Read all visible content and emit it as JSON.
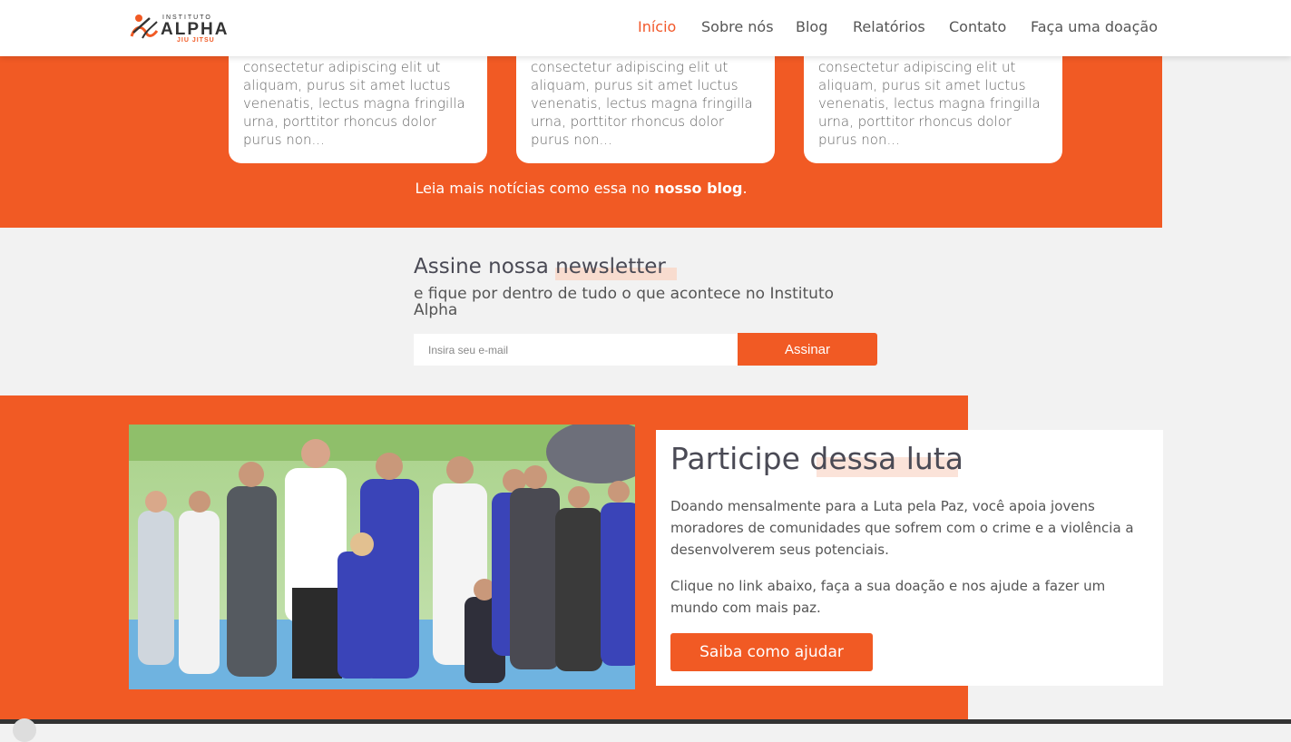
{
  "header": {
    "logo": {
      "line1": "INSTITUTO",
      "line2": "ALPHA",
      "line3": "JIU JITSU"
    },
    "nav": [
      {
        "label": "Início",
        "active": true
      },
      {
        "label": "Sobre nós",
        "active": false
      },
      {
        "label": "Blog",
        "active": false
      },
      {
        "label": "Relatórios",
        "active": false
      },
      {
        "label": "Contato",
        "active": false
      },
      {
        "label": "Faça uma doação",
        "active": false
      }
    ]
  },
  "blog": {
    "cards": [
      {
        "excerpt": "consectetur adipiscing elit ut aliquam, purus sit amet luctus venenatis, lectus magna fringilla urna, porttitor rhoncus dolor purus non..."
      },
      {
        "excerpt": "consectetur adipiscing elit ut aliquam, purus sit amet luctus venenatis, lectus magna fringilla urna, porttitor rhoncus dolor purus non..."
      },
      {
        "excerpt": "consectetur adipiscing elit ut aliquam, purus sit amet luctus venenatis, lectus magna fringilla urna, porttitor rhoncus dolor purus non..."
      }
    ],
    "more_prefix": "Leia mais notícias como essa no ",
    "more_link": "nosso blog",
    "more_suffix": "."
  },
  "newsletter": {
    "title": "Assine nossa newsletter",
    "subtitle": "e fique por dentro de tudo o que acontece no Instituto Alpha",
    "input_placeholder": "Insira seu e-mail",
    "button": "Assinar"
  },
  "participe": {
    "title": "Participe dessa luta",
    "paragraph1": "Doando mensalmente para a Luta pela Paz, você apoia jovens moradores de comunidades que sofrem com o crime e a violência a desenvolverem seus potenciais.",
    "paragraph2": "Clique no link abaixo, faça a sua doação e nos ajude a fazer um mundo com mais paz.",
    "button": "Saiba como ajudar"
  },
  "colors": {
    "accent": "#f15a24",
    "text": "#4a4a55",
    "background": "#f2f2f2"
  }
}
